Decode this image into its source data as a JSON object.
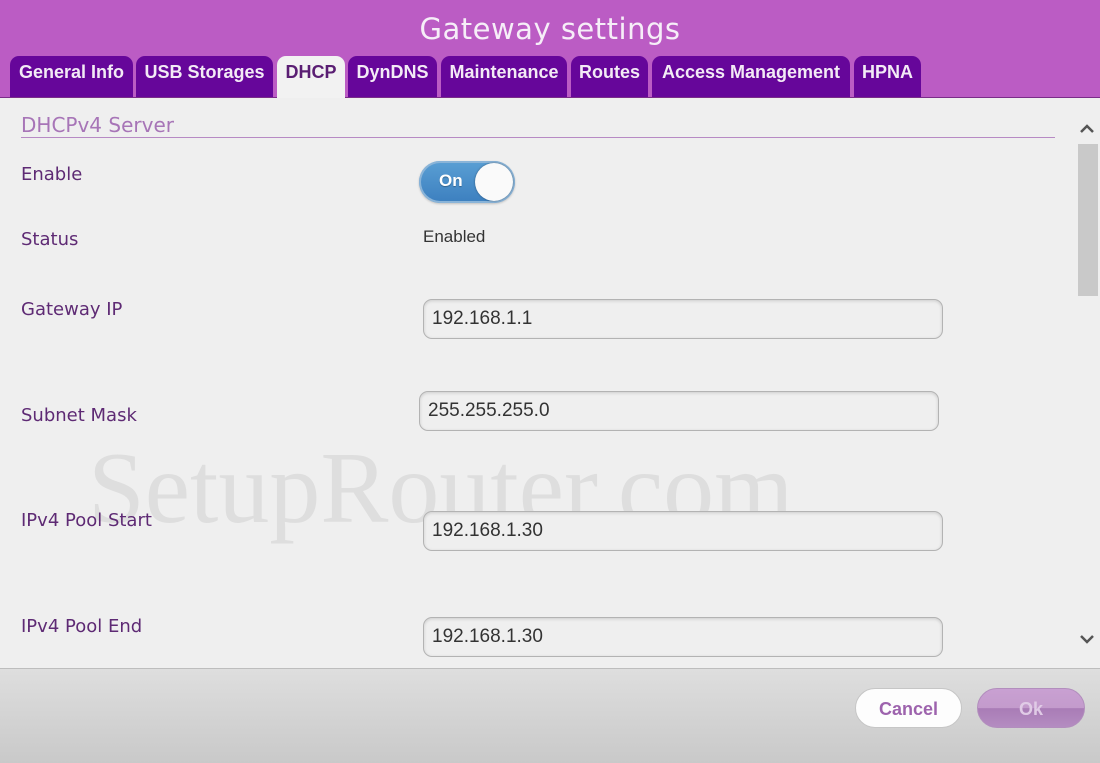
{
  "header": {
    "title": "Gateway settings"
  },
  "tabs": [
    {
      "label": "General Info",
      "active": false
    },
    {
      "label": "USB Storages",
      "active": false
    },
    {
      "label": "DHCP",
      "active": true
    },
    {
      "label": "DynDNS",
      "active": false
    },
    {
      "label": "Maintenance",
      "active": false
    },
    {
      "label": "Routes",
      "active": false
    },
    {
      "label": "Access Management",
      "active": false
    },
    {
      "label": "HPNA",
      "active": false
    }
  ],
  "section": {
    "title": "DHCPv4 Server"
  },
  "fields": {
    "enable": {
      "label": "Enable",
      "toggle_text": "On",
      "state": "on"
    },
    "status": {
      "label": "Status",
      "value": "Enabled"
    },
    "gateway_ip": {
      "label": "Gateway IP",
      "value": "192.168.1.1"
    },
    "subnet_mask": {
      "label": "Subnet Mask",
      "value": "255.255.255.0"
    },
    "pool_start": {
      "label": "IPv4 Pool Start",
      "value": "192.168.1.30"
    },
    "pool_end": {
      "label": "IPv4 Pool End",
      "value": "192.168.1.30"
    }
  },
  "watermark": "SetupRouter.com",
  "scrollbar": {
    "up_icon": "⌃",
    "down_icon": "⌄"
  },
  "footer": {
    "cancel_label": "Cancel",
    "ok_label": "Ok"
  },
  "colors": {
    "header_bg": "#bb5cc4",
    "tab_bg": "#66069a",
    "label_color": "#5e2a74",
    "toggle_on": "#4a8fcb"
  }
}
